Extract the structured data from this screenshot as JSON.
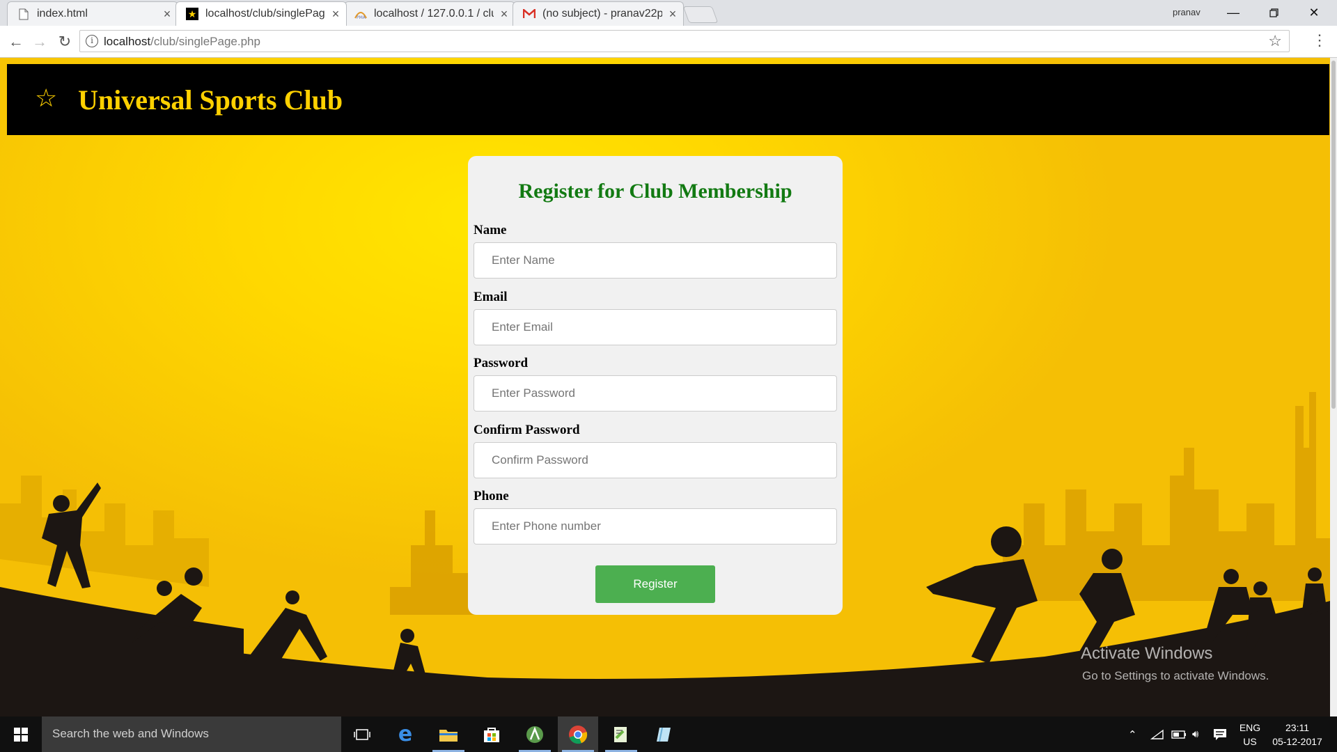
{
  "browser": {
    "tabs": [
      {
        "title": "index.html",
        "icon": "file-icon"
      },
      {
        "title": "localhost/club/singlePag",
        "icon": "star-favicon-icon"
      },
      {
        "title": "localhost / 127.0.0.1 / clu",
        "icon": "phpmyadmin-icon"
      },
      {
        "title": "(no subject) - pranav22p",
        "icon": "gmail-icon"
      }
    ],
    "active_tab": 1,
    "user": "pranav",
    "address": {
      "host": "localhost",
      "path": "/club/singlePage.php"
    }
  },
  "site": {
    "title": "Universal Sports Club",
    "brand_color": "#ffd100"
  },
  "form": {
    "heading": "Register for Club Membership",
    "fields": [
      {
        "label": "Name",
        "placeholder": "Enter Name"
      },
      {
        "label": "Email",
        "placeholder": "Enter Email"
      },
      {
        "label": "Password",
        "placeholder": "Enter Password"
      },
      {
        "label": "Confirm Password",
        "placeholder": "Confirm Password"
      },
      {
        "label": "Phone",
        "placeholder": "Enter Phone number"
      }
    ],
    "submit_label": "Register",
    "heading_color": "#127a12",
    "button_color": "#4caf50"
  },
  "watermark": {
    "line1": "Activate Windows",
    "line2": "Go to Settings to activate Windows."
  },
  "taskbar": {
    "search_placeholder": "Search the web and Windows",
    "language": "ENG",
    "region": "US",
    "time": "23:11",
    "date": "05-12-2017"
  }
}
